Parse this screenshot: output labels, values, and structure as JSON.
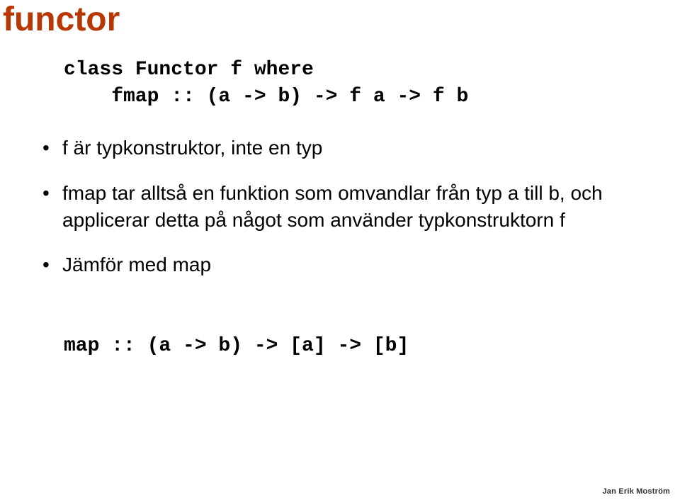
{
  "title": "functor",
  "code1_line1": "class Functor f where",
  "code1_line2": "    fmap :: (a -> b) -> f a -> f b",
  "bullets": {
    "b1": "f är typkonstruktor, inte en typ",
    "b2": "fmap tar alltså en funktion som omvandlar från typ a till b, och applicerar detta på något som använder typkonstruktorn f",
    "b3": "Jämför med map"
  },
  "code2": "map :: (a -> b) -> [a] -> [b]",
  "footer": "Jan Erik Moström"
}
